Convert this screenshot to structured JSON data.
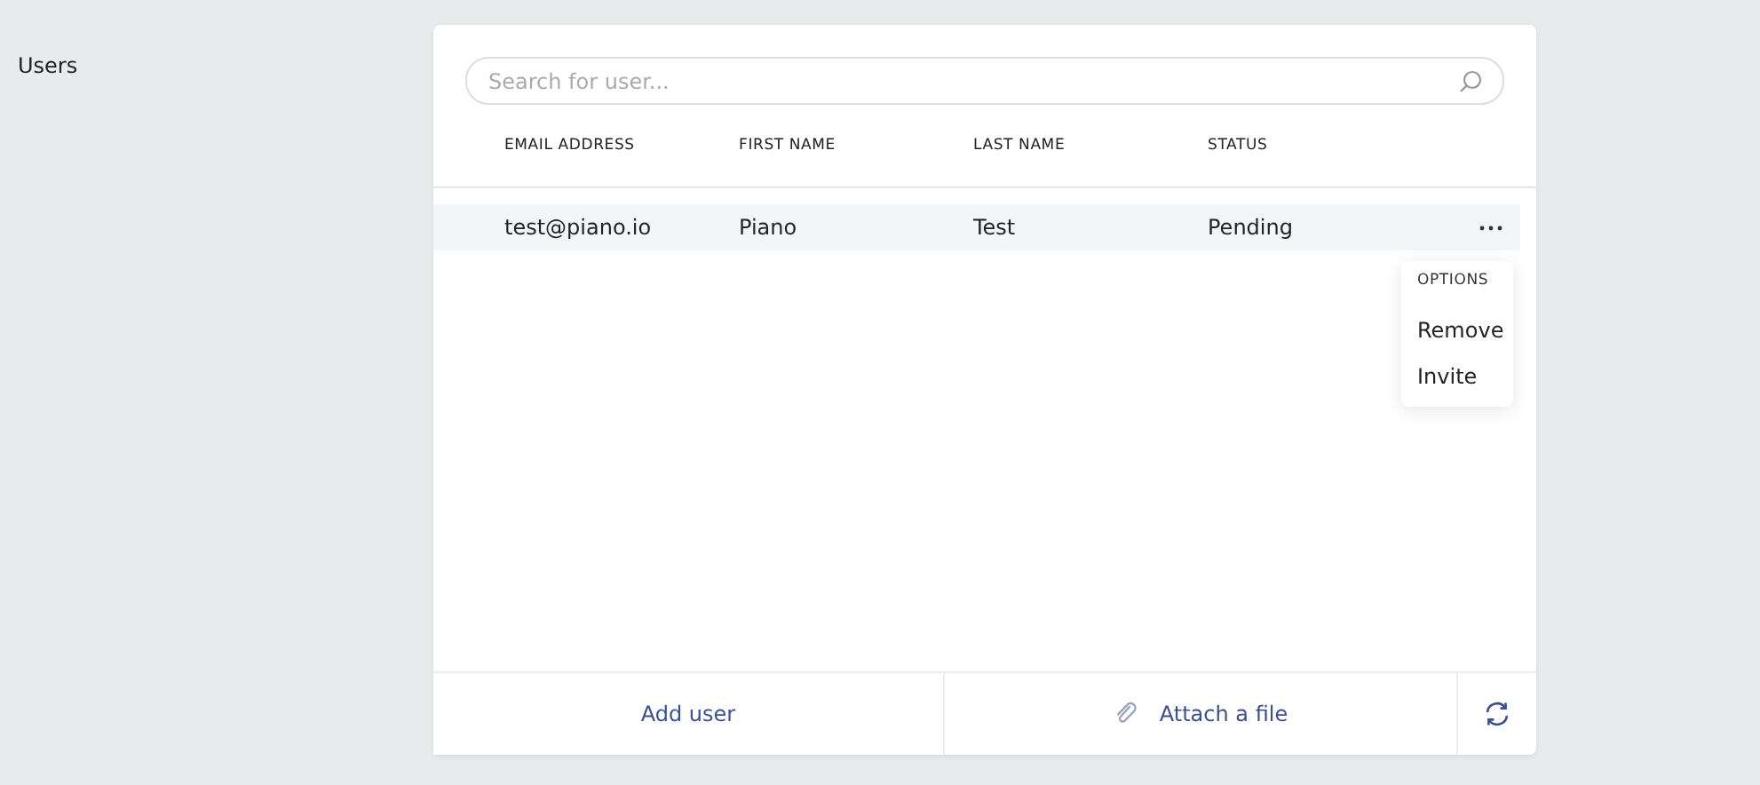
{
  "section_label": "Users",
  "search": {
    "placeholder": "Search for user..."
  },
  "table": {
    "columns": [
      "EMAIL ADDRESS",
      "FIRST NAME",
      "LAST NAME",
      "STATUS"
    ],
    "rows": [
      {
        "cells": [
          "test@piano.io",
          "Piano",
          "Test",
          "Pending"
        ],
        "selected": true
      }
    ]
  },
  "options_menu": {
    "title": "OPTIONS",
    "items": [
      "Remove",
      "Invite"
    ]
  },
  "footer": {
    "add_button": "Add user",
    "attach_button": "Attach a file"
  }
}
